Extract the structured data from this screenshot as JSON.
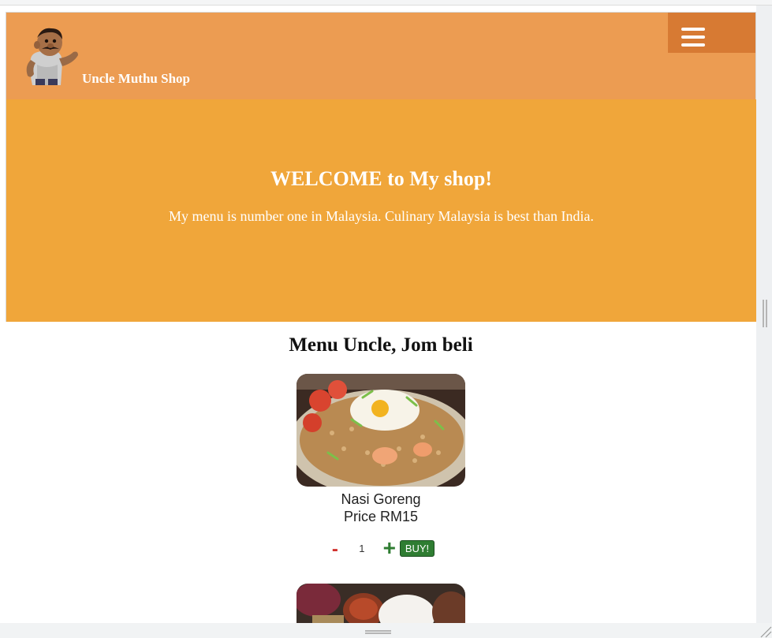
{
  "header": {
    "shop_name": "Uncle Muthu Shop",
    "logo_icon": "uncle-muthu-mascot-icon",
    "menu_icon": "hamburger-menu-icon"
  },
  "hero": {
    "title": "WELCOME to My shop!",
    "subtitle": "My menu is number one in Malaysia. Culinary Malaysia is best than India."
  },
  "menu": {
    "title": "Menu Uncle, Jom beli",
    "items": [
      {
        "name": "Nasi Goreng",
        "price": "Price RM15",
        "quantity": "1",
        "minus_label": "-",
        "plus_label": "+",
        "buy_label": "BUY!",
        "image_icon": "fried-rice-photo"
      },
      {
        "image_icon": "nasi-lemak-photo"
      }
    ]
  },
  "colors": {
    "header_bg": "#ec9c52",
    "menu_button_bg": "#d77a33",
    "hero_bg": "#f0a63a",
    "buy_button_bg": "#2f7d32",
    "minus_color": "#d0312d",
    "plus_color": "#2f7d32"
  }
}
